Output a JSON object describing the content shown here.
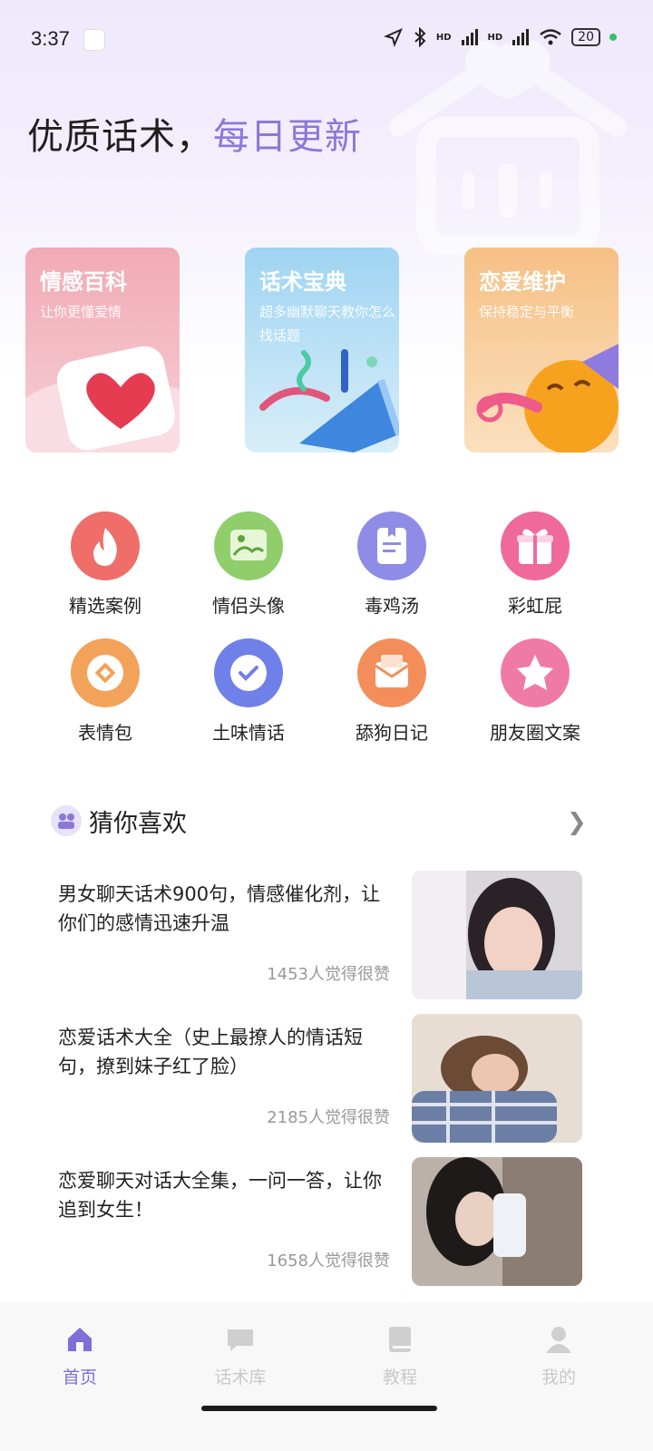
{
  "status": {
    "time": "3:37",
    "battery": "20",
    "net1": "HD",
    "net2": "HD"
  },
  "headline": {
    "main": "优质话术，",
    "accent": "每日更新"
  },
  "cards": [
    {
      "title": "情感百科",
      "subtitle": "让你更懂爱情"
    },
    {
      "title": "话术宝典",
      "subtitle": "超多幽默聊天教你怎么找话题"
    },
    {
      "title": "恋爱维护",
      "subtitle": "保持稳定与平衡"
    }
  ],
  "grid": [
    {
      "label": "精选案例",
      "color": "#ef6e6a"
    },
    {
      "label": "情侣头像",
      "color": "#8fce6b"
    },
    {
      "label": "毒鸡汤",
      "color": "#8e8ce6"
    },
    {
      "label": "彩虹屁",
      "color": "#f0699b"
    },
    {
      "label": "表情包",
      "color": "#f3a25a"
    },
    {
      "label": "土味情话",
      "color": "#6f80e8"
    },
    {
      "label": "舔狗日记",
      "color": "#f38e5b"
    },
    {
      "label": "朋友圈文案",
      "color": "#f07aa6"
    }
  ],
  "section": {
    "title": "猜你喜欢"
  },
  "feed": [
    {
      "title": "男女聊天话术900句，情感催化剂，让你们的感情迅速升温",
      "likes": "1453人觉得很赞"
    },
    {
      "title": "恋爱话术大全（史上最撩人的情话短句，撩到妹子红了脸）",
      "likes": "2185人觉得很赞"
    },
    {
      "title": "恋爱聊天对话大全集，一问一答，让你追到女生！",
      "likes": "1658人觉得很赞"
    }
  ],
  "nav": [
    {
      "label": "首页"
    },
    {
      "label": "话术库"
    },
    {
      "label": "教程"
    },
    {
      "label": "我的"
    }
  ],
  "colors": {
    "accent": "#8a79d8",
    "nav_active": "#7f6fd6"
  }
}
